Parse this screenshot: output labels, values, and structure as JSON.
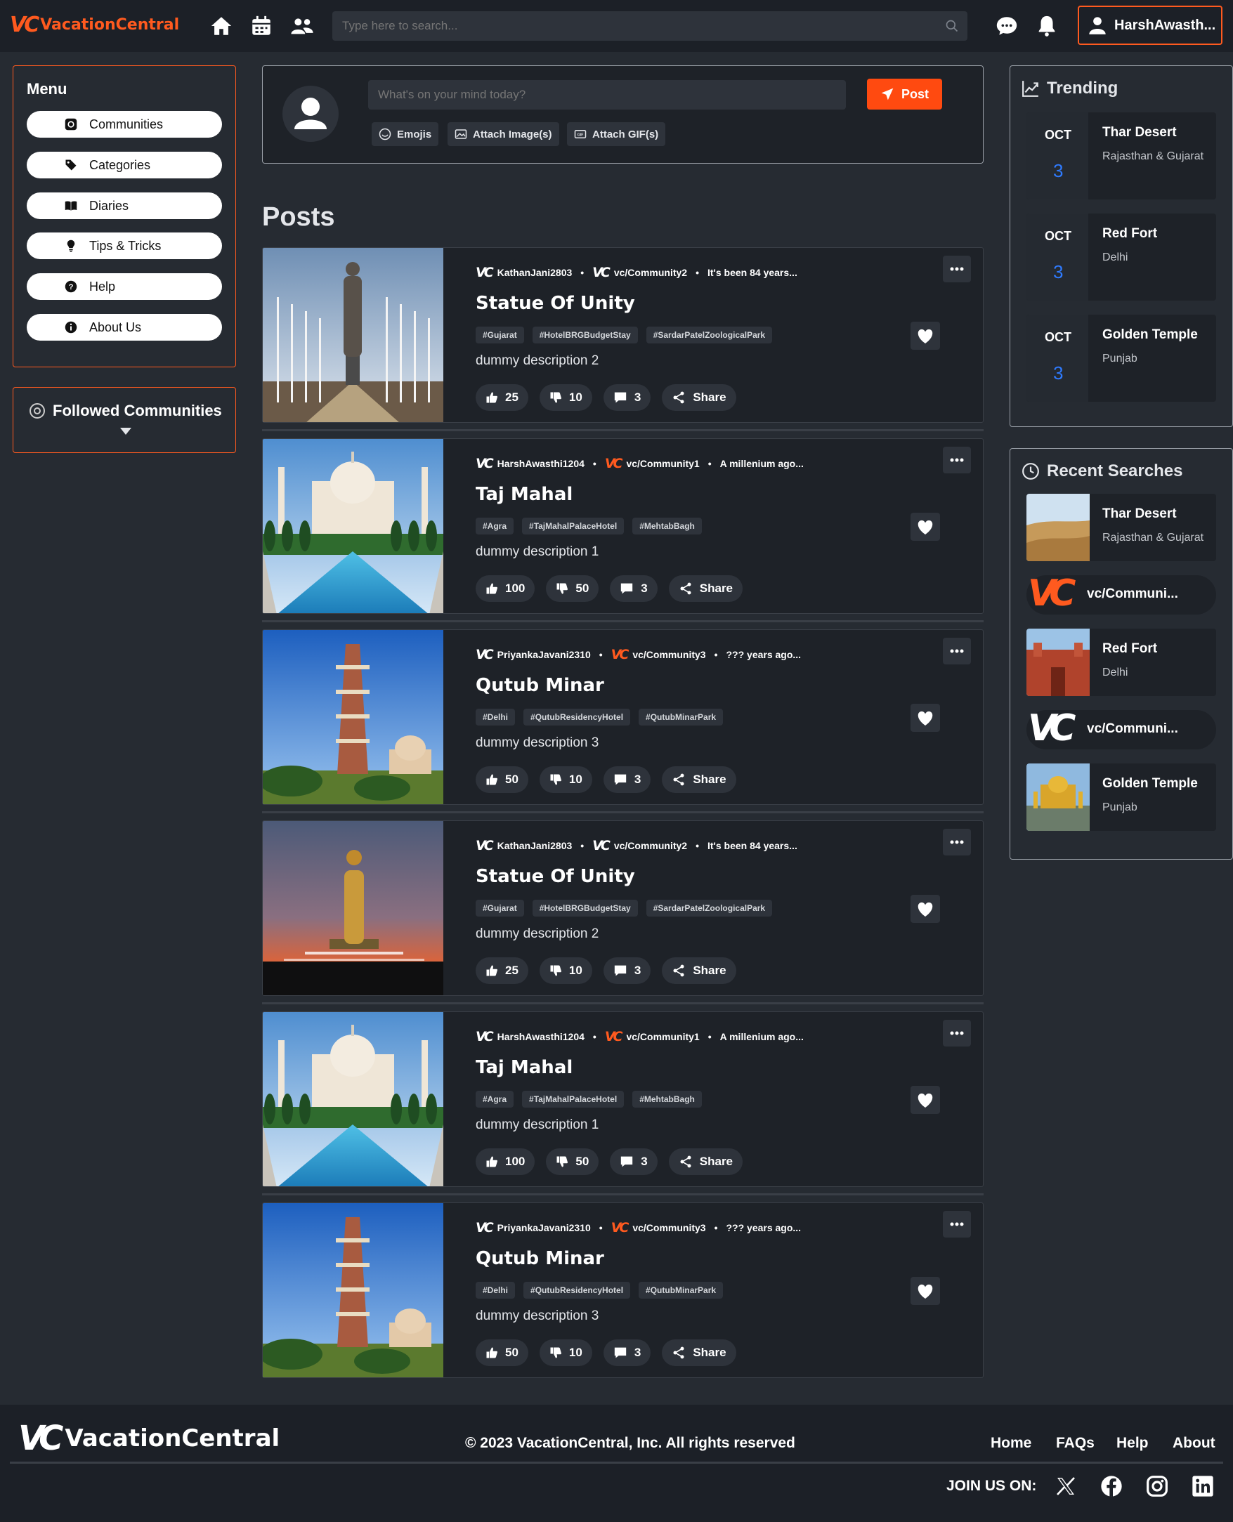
{
  "header": {
    "logo_mark": "VC",
    "logo_text": "VacationCentral",
    "search_placeholder": "Type here to search...",
    "user_name": "HarshAwasth..."
  },
  "menu": {
    "title": "Menu",
    "items": [
      {
        "label": "Communities",
        "icon": "threads-icon"
      },
      {
        "label": "Categories",
        "icon": "tag-icon"
      },
      {
        "label": "Diaries",
        "icon": "book-icon"
      },
      {
        "label": "Tips & Tricks",
        "icon": "lightbulb-icon"
      },
      {
        "label": "Help",
        "icon": "question-icon"
      },
      {
        "label": "About Us",
        "icon": "info-icon"
      }
    ]
  },
  "followed": {
    "title": "Followed Communities"
  },
  "composer": {
    "placeholder": "What's on your mind today?",
    "post_label": "Post",
    "emojis_label": "Emojis",
    "images_label": "Attach Image(s)",
    "gifs_label": "Attach GIF(s)"
  },
  "posts_heading": "Posts",
  "posts": [
    {
      "author": "KathanJani2803",
      "community": "vc/Community2",
      "time": "It's been 84 years...",
      "title": "Statue Of Unity",
      "tags": [
        "#Gujarat",
        "#HotelBRGBudgetStay",
        "#SardarPatelZoologicalPark"
      ],
      "description": "dummy description 2",
      "likes": "25",
      "dislikes": "10",
      "comments": "3",
      "share": "Share",
      "image": "statue-day",
      "community_color": "#ffffff"
    },
    {
      "author": "HarshAwasthi1204",
      "community": "vc/Community1",
      "time": "A millenium ago...",
      "title": "Taj Mahal",
      "tags": [
        "#Agra",
        "#TajMahalPalaceHotel",
        "#MehtabBagh"
      ],
      "description": "dummy description 1",
      "likes": "100",
      "dislikes": "50",
      "comments": "3",
      "share": "Share",
      "image": "taj",
      "community_color": "#ff5a1f"
    },
    {
      "author": "PriyankaJavani2310",
      "community": "vc/Community3",
      "time": "??? years ago...",
      "title": "Qutub Minar",
      "tags": [
        "#Delhi",
        "#QutubResidencyHotel",
        "#QutubMinarPark"
      ],
      "description": "dummy description 3",
      "likes": "50",
      "dislikes": "10",
      "comments": "3",
      "share": "Share",
      "image": "qutub",
      "community_color": "#ff5a1f"
    },
    {
      "author": "KathanJani2803",
      "community": "vc/Community2",
      "time": "It's been 84 years...",
      "title": "Statue Of Unity",
      "tags": [
        "#Gujarat",
        "#HotelBRGBudgetStay",
        "#SardarPatelZoologicalPark"
      ],
      "description": "dummy description 2",
      "likes": "25",
      "dislikes": "10",
      "comments": "3",
      "share": "Share",
      "image": "statue-night",
      "community_color": "#ffffff"
    },
    {
      "author": "HarshAwasthi1204",
      "community": "vc/Community1",
      "time": "A millenium ago...",
      "title": "Taj Mahal",
      "tags": [
        "#Agra",
        "#TajMahalPalaceHotel",
        "#MehtabBagh"
      ],
      "description": "dummy description 1",
      "likes": "100",
      "dislikes": "50",
      "comments": "3",
      "share": "Share",
      "image": "taj",
      "community_color": "#ff5a1f"
    },
    {
      "author": "PriyankaJavani2310",
      "community": "vc/Community3",
      "time": "??? years ago...",
      "title": "Qutub Minar",
      "tags": [
        "#Delhi",
        "#QutubResidencyHotel",
        "#QutubMinarPark"
      ],
      "description": "dummy description 3",
      "likes": "50",
      "dislikes": "10",
      "comments": "3",
      "share": "Share",
      "image": "qutub",
      "community_color": "#ff5a1f"
    }
  ],
  "trending": {
    "title": "Trending",
    "items": [
      {
        "month": "OCT",
        "day": "3",
        "name": "Thar Desert",
        "location": "Rajasthan & Gujarat"
      },
      {
        "month": "OCT",
        "day": "3",
        "name": "Red Fort",
        "location": "Delhi"
      },
      {
        "month": "OCT",
        "day": "3",
        "name": "Golden Temple",
        "location": "Punjab"
      }
    ]
  },
  "recent": {
    "title": "Recent Searches",
    "items": [
      {
        "type": "place",
        "name": "Thar Desert",
        "location": "Rajasthan & Gujarat",
        "image": "desert"
      },
      {
        "type": "community",
        "name": "vc/Communi...",
        "color": "#ff5a1f"
      },
      {
        "type": "place",
        "name": "Red Fort",
        "location": "Delhi",
        "image": "redfort"
      },
      {
        "type": "community",
        "name": "vc/Communi...",
        "color": "#ffffff"
      },
      {
        "type": "place",
        "name": "Golden Temple",
        "location": "Punjab",
        "image": "golden"
      }
    ]
  },
  "footer": {
    "logo_mark": "VC",
    "logo_text": "VacationCentral",
    "copyright": "© 2023 VacationCentral, Inc. All rights reserved",
    "links": [
      "Home",
      "FAQs",
      "Help",
      "About"
    ],
    "join_label": "JOIN US ON:",
    "socials": [
      "x-icon",
      "facebook-icon",
      "instagram-icon",
      "linkedin-icon"
    ]
  },
  "colors": {
    "accent": "#ff5a1f",
    "background": "#262b32",
    "card": "#1e2228",
    "date_blue": "#2f7bff"
  }
}
